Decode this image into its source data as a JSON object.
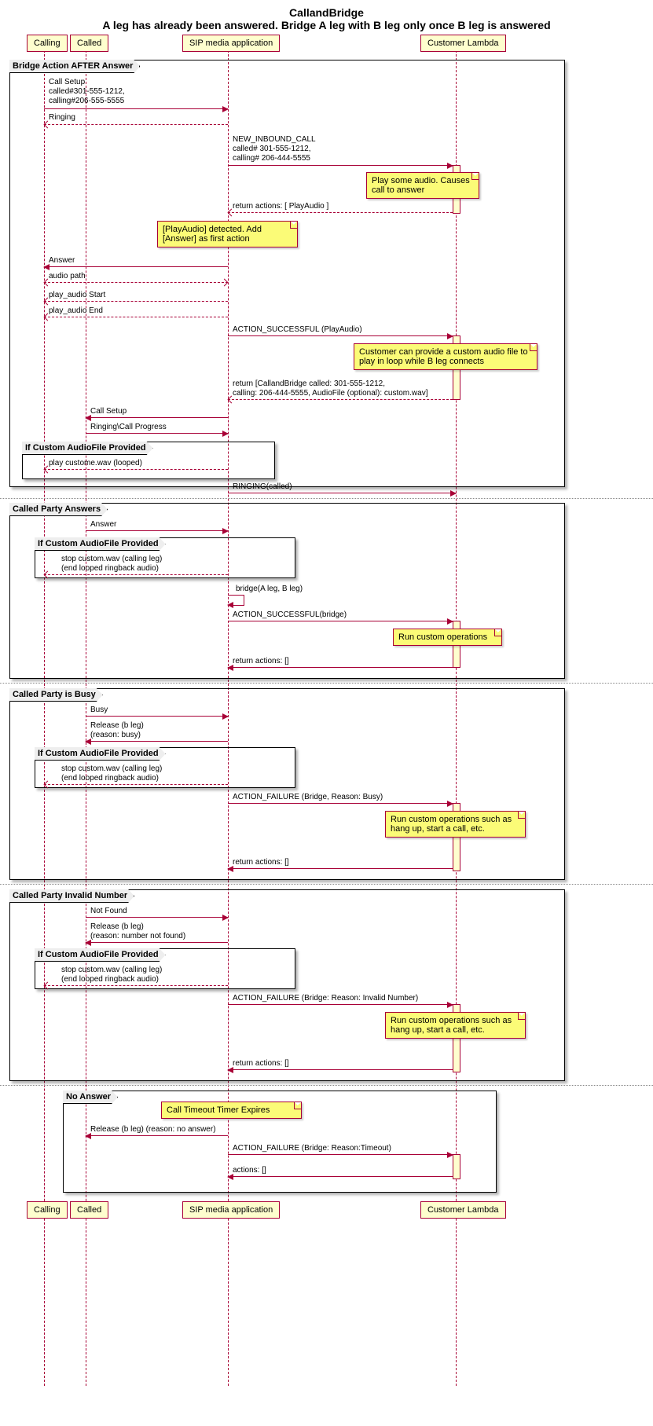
{
  "title": {
    "main": "CallandBridge",
    "sub": "A leg has already been answered. Bridge A leg with B leg only once B leg is answered"
  },
  "participants": {
    "calling": "Calling",
    "called": "Called",
    "sma": "SIP media application",
    "lambda": "Customer Lambda"
  },
  "groups": {
    "g1": "Bridge Action AFTER Answer",
    "g2": "If Custom AudioFile Provided",
    "g3": "Called Party Answers",
    "g4": "If Custom AudioFile Provided",
    "g5": "Called Party is Busy",
    "g6": "If Custom AudioFile Provided",
    "g7": "Called Party Invalid Number",
    "g8": "If Custom AudioFile Provided",
    "g9": "No Answer"
  },
  "notes": {
    "n1": "Play some audio.\nCauses call to answer",
    "n2": "[PlayAudio] detected.\nAdd [Answer] as first action",
    "n3": "Customer can provide a custom audio file\nto play in loop while B leg connects",
    "n4": "Run custom operations",
    "n5": "Run custom operations such\nas hang up, start a call, etc.",
    "n6": "Run custom operations such\nas hang up, start a call, etc.",
    "n7": "Call Timeout Timer Expires"
  },
  "messages": {
    "m1": "Call Setup\ncalled#301-555-1212,\ncalling#206-555-5555",
    "m2": "Ringing",
    "m3": "NEW_INBOUND_CALL\ncalled# 301-555-1212,\ncalling# 206-444-5555",
    "m4": "return actions: [ PlayAudio ]",
    "m5": "Answer",
    "m6": "audio path",
    "m7": "play_audio Start",
    "m8": "play_audio End",
    "m9": "ACTION_SUCCESSFUL (PlayAudio)",
    "m10": "return [CallandBridge called: 301-555-1212,\ncalling: 206-444-5555, AudioFile (optional): custom.wav]",
    "m11": "Call Setup",
    "m12": "Ringing\\Call Progress",
    "m13": "play custome.wav (looped)",
    "m14": "RINGING(called)",
    "m15": "Answer",
    "m16": "stop custom.wav (calling leg)\n(end looped ringback audio)",
    "m17": "bridge(A leg, B leg)",
    "m18": "ACTION_SUCCESSFUL(bridge)",
    "m19": "return actions: []",
    "m20": "Busy",
    "m21": "Release (b leg)\n(reason: busy)",
    "m22": "stop custom.wav (calling leg)\n(end looped ringback audio)",
    "m23": "ACTION_FAILURE (Bridge, Reason: Busy)",
    "m24": "return actions: []",
    "m25": "Not Found",
    "m26": "Release (b leg)\n(reason: number not found)",
    "m27": "stop custom.wav (calling leg)\n(end looped ringback audio)",
    "m28": "ACTION_FAILURE (Bridge: Reason: Invalid Number)",
    "m29": "return actions: []",
    "m30": "Release (b leg) (reason: no answer)",
    "m31": "ACTION_FAILURE (Bridge: Reason:Timeout)",
    "m32": "actions: []"
  }
}
